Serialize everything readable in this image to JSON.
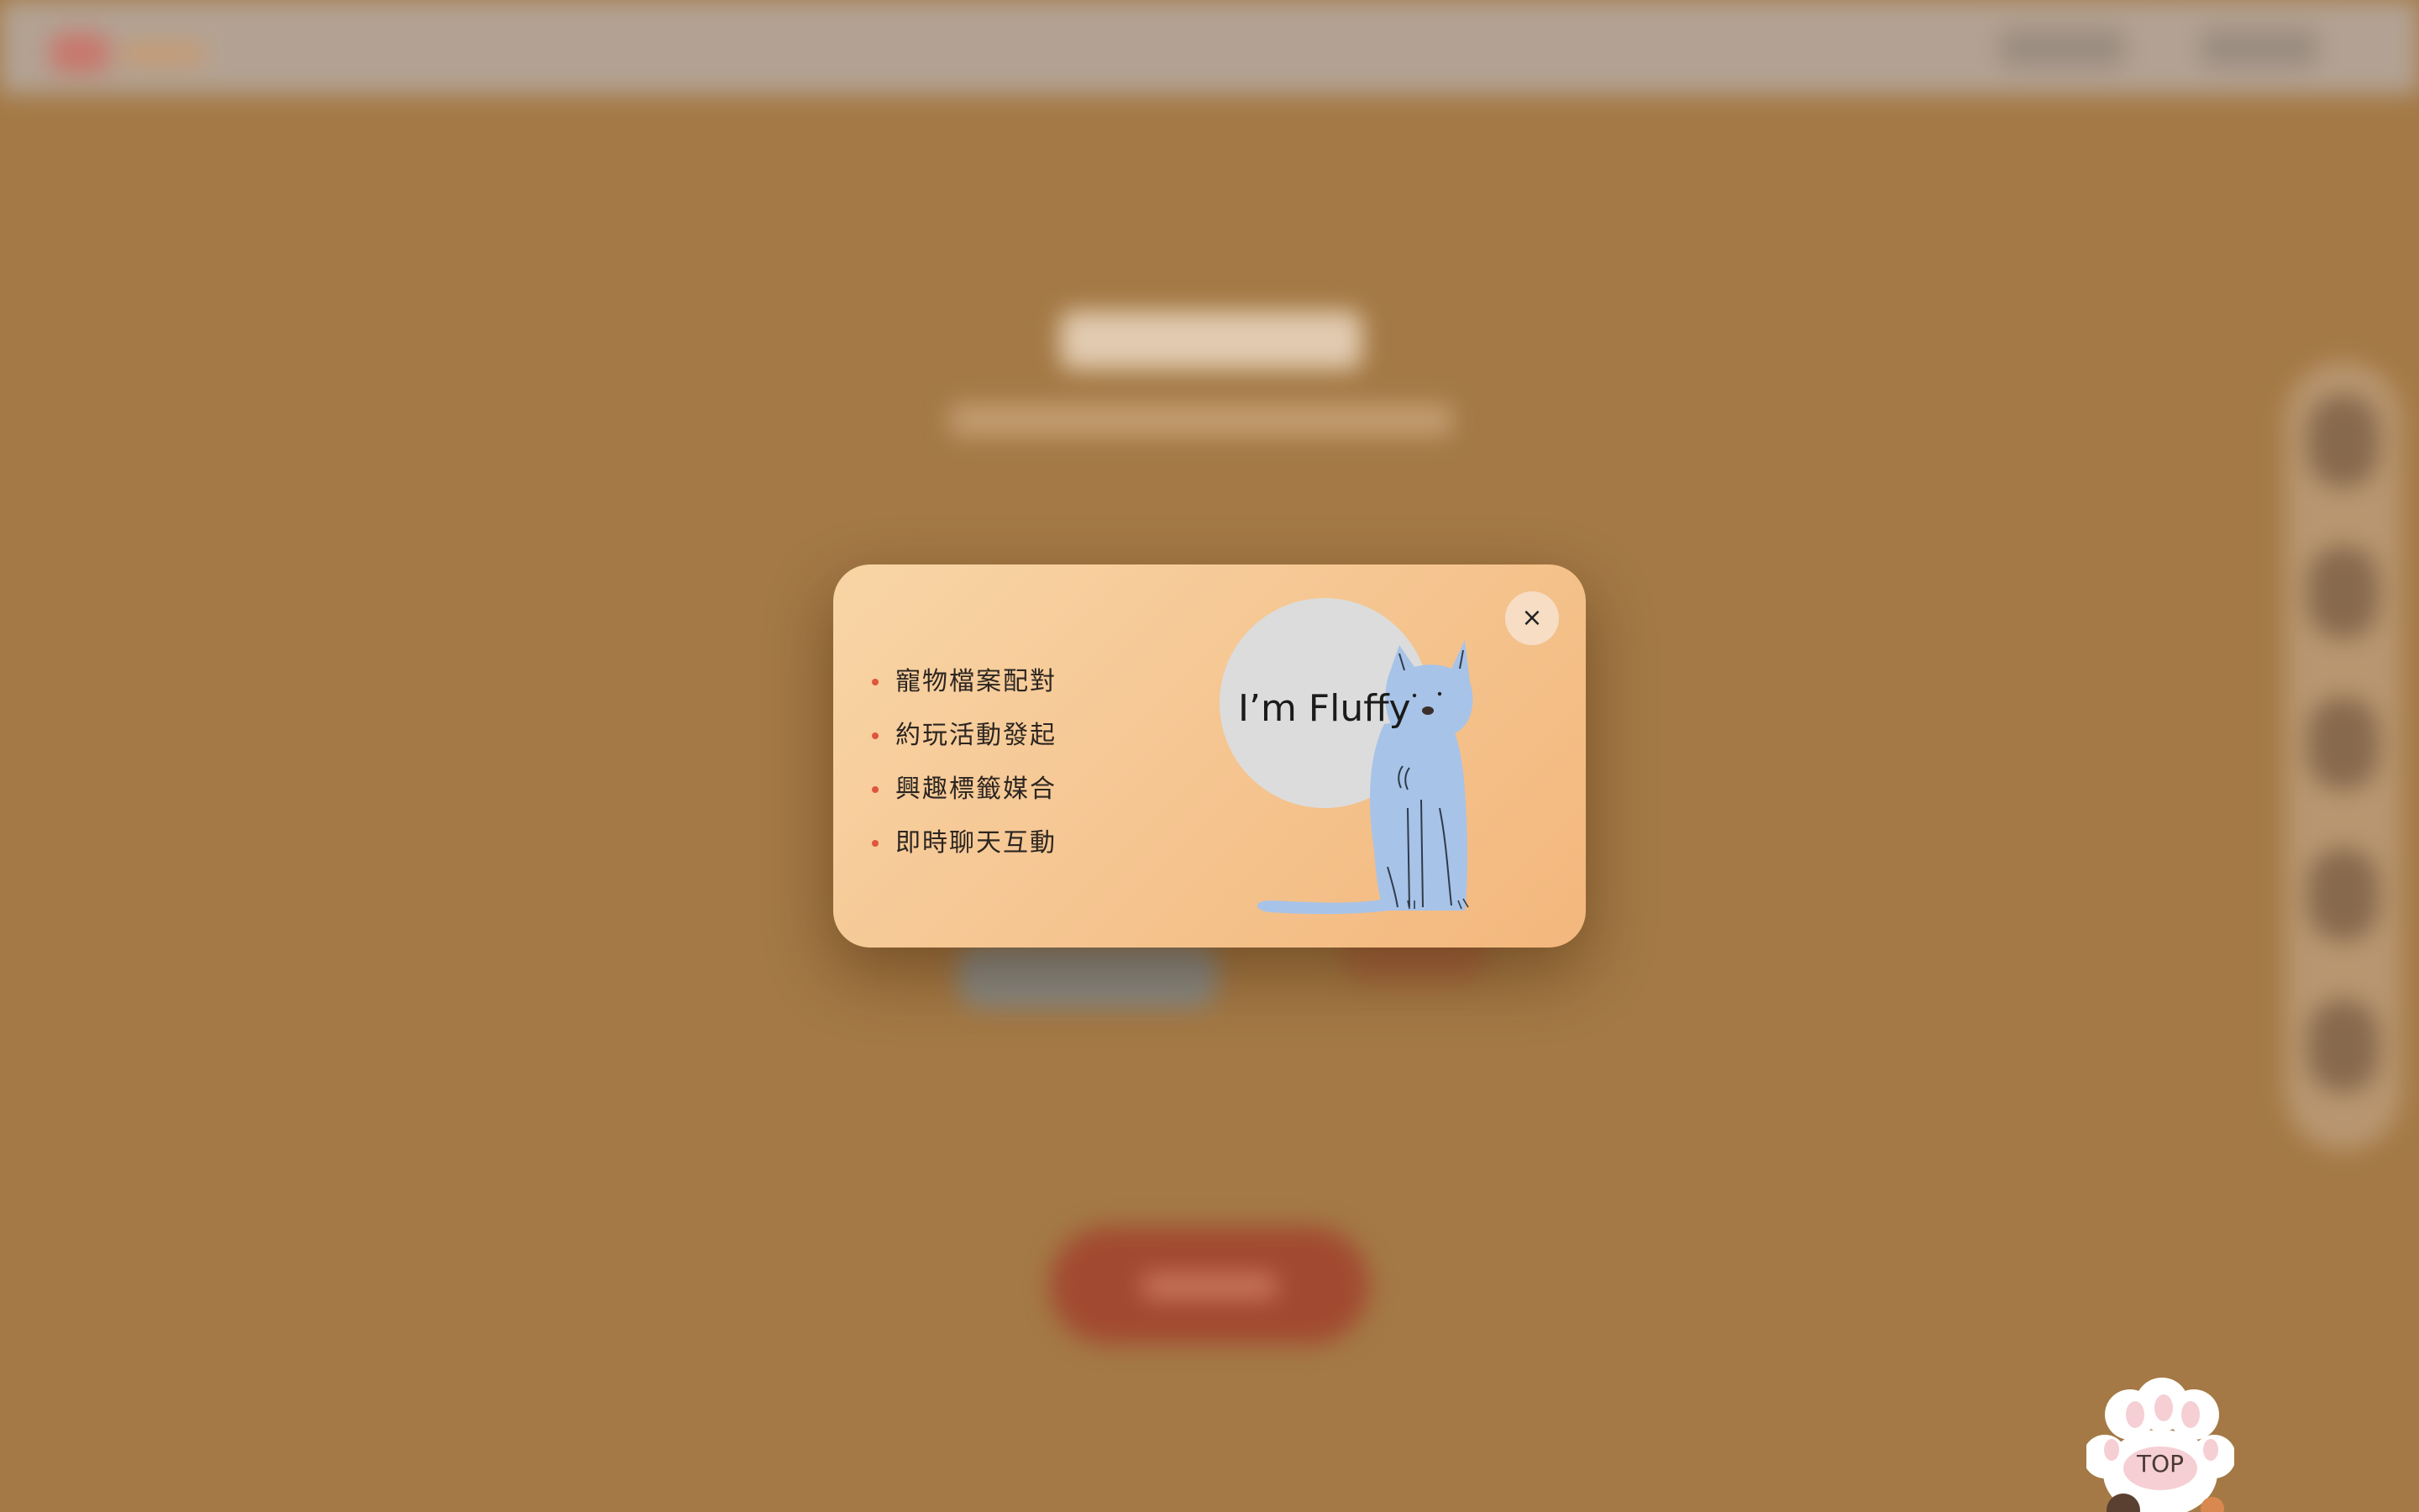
{
  "popup": {
    "features": [
      "寵物檔案配對",
      "約玩活動發起",
      "興趣標籤媒合",
      "即時聊天互動"
    ],
    "pet_bubble_text": "I’m Fluffy",
    "close_label": "×"
  },
  "back_to_top": {
    "label": "TOP"
  },
  "colors": {
    "overlay_background": "#a47945",
    "modal_gradient_start": "#f8d5a6",
    "modal_gradient_end": "#f3b77c",
    "bullet": "#e0553d",
    "cat_fill": "#a8c3e8",
    "bubble": "#dcdcdc"
  }
}
